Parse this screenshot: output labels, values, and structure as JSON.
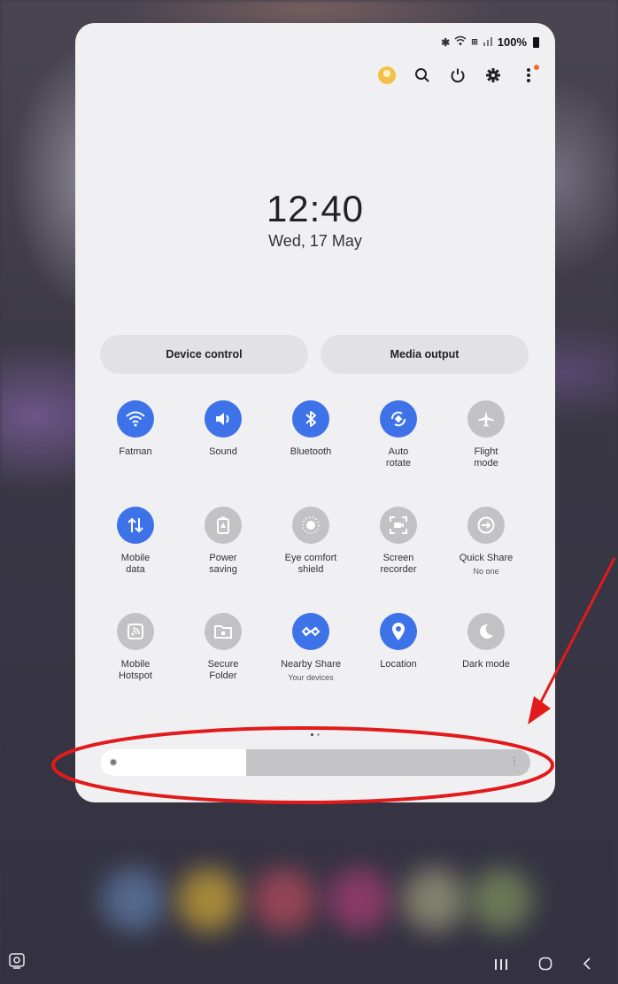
{
  "status_bar": {
    "battery": "100%"
  },
  "clock": {
    "time": "12:40",
    "date": "Wed, 17 May"
  },
  "buttons": {
    "device_control": "Device control",
    "media_output": "Media output"
  },
  "tiles": [
    {
      "label": "Fatman",
      "sub": "",
      "state": "on",
      "icon": "wifi-icon"
    },
    {
      "label": "Sound",
      "sub": "",
      "state": "on",
      "icon": "sound-icon"
    },
    {
      "label": "Bluetooth",
      "sub": "",
      "state": "on",
      "icon": "bluetooth-icon"
    },
    {
      "label": "Auto rotate",
      "sub": "",
      "state": "on",
      "icon": "auto-rotate-icon"
    },
    {
      "label": "Flight mode",
      "sub": "",
      "state": "off",
      "icon": "airplane-icon"
    },
    {
      "label": "Mobile data",
      "sub": "",
      "state": "on",
      "icon": "mobile-data-icon"
    },
    {
      "label": "Power saving",
      "sub": "",
      "state": "off",
      "icon": "battery-icon"
    },
    {
      "label": "Eye comfort shield",
      "sub": "",
      "state": "off",
      "icon": "eye-comfort-icon"
    },
    {
      "label": "Screen recorder",
      "sub": "",
      "state": "off",
      "icon": "screen-recorder-icon"
    },
    {
      "label": "Quick Share",
      "sub": "No one",
      "state": "off",
      "icon": "quick-share-icon"
    },
    {
      "label": "Mobile Hotspot",
      "sub": "",
      "state": "off",
      "icon": "hotspot-icon"
    },
    {
      "label": "Secure Folder",
      "sub": "",
      "state": "off",
      "icon": "secure-folder-icon"
    },
    {
      "label": "Nearby Share",
      "sub": "Your devices",
      "state": "on",
      "icon": "nearby-share-icon"
    },
    {
      "label": "Location",
      "sub": "",
      "state": "on",
      "icon": "location-icon"
    },
    {
      "label": "Dark mode",
      "sub": "",
      "state": "off",
      "icon": "dark-mode-icon"
    }
  ],
  "tile_labels": [
    [
      "Fatman"
    ],
    [
      "Sound"
    ],
    [
      "Bluetooth"
    ],
    [
      "Auto",
      "rotate"
    ],
    [
      "Flight",
      "mode"
    ],
    [
      "Mobile",
      "data"
    ],
    [
      "Power",
      "saving"
    ],
    [
      "Eye comfort",
      "shield"
    ],
    [
      "Screen",
      "recorder"
    ],
    [
      "Quick Share"
    ],
    [
      "Mobile",
      "Hotspot"
    ],
    [
      "Secure",
      "Folder"
    ],
    [
      "Nearby Share"
    ],
    [
      "Location"
    ],
    [
      "Dark mode"
    ]
  ],
  "brightness": {
    "level": 0.34
  },
  "colors": {
    "accent": "#3e72e8",
    "tile_off": "#c2c2c5",
    "annotation": "#e11b1b",
    "notification_dot": "#f36b2a"
  }
}
